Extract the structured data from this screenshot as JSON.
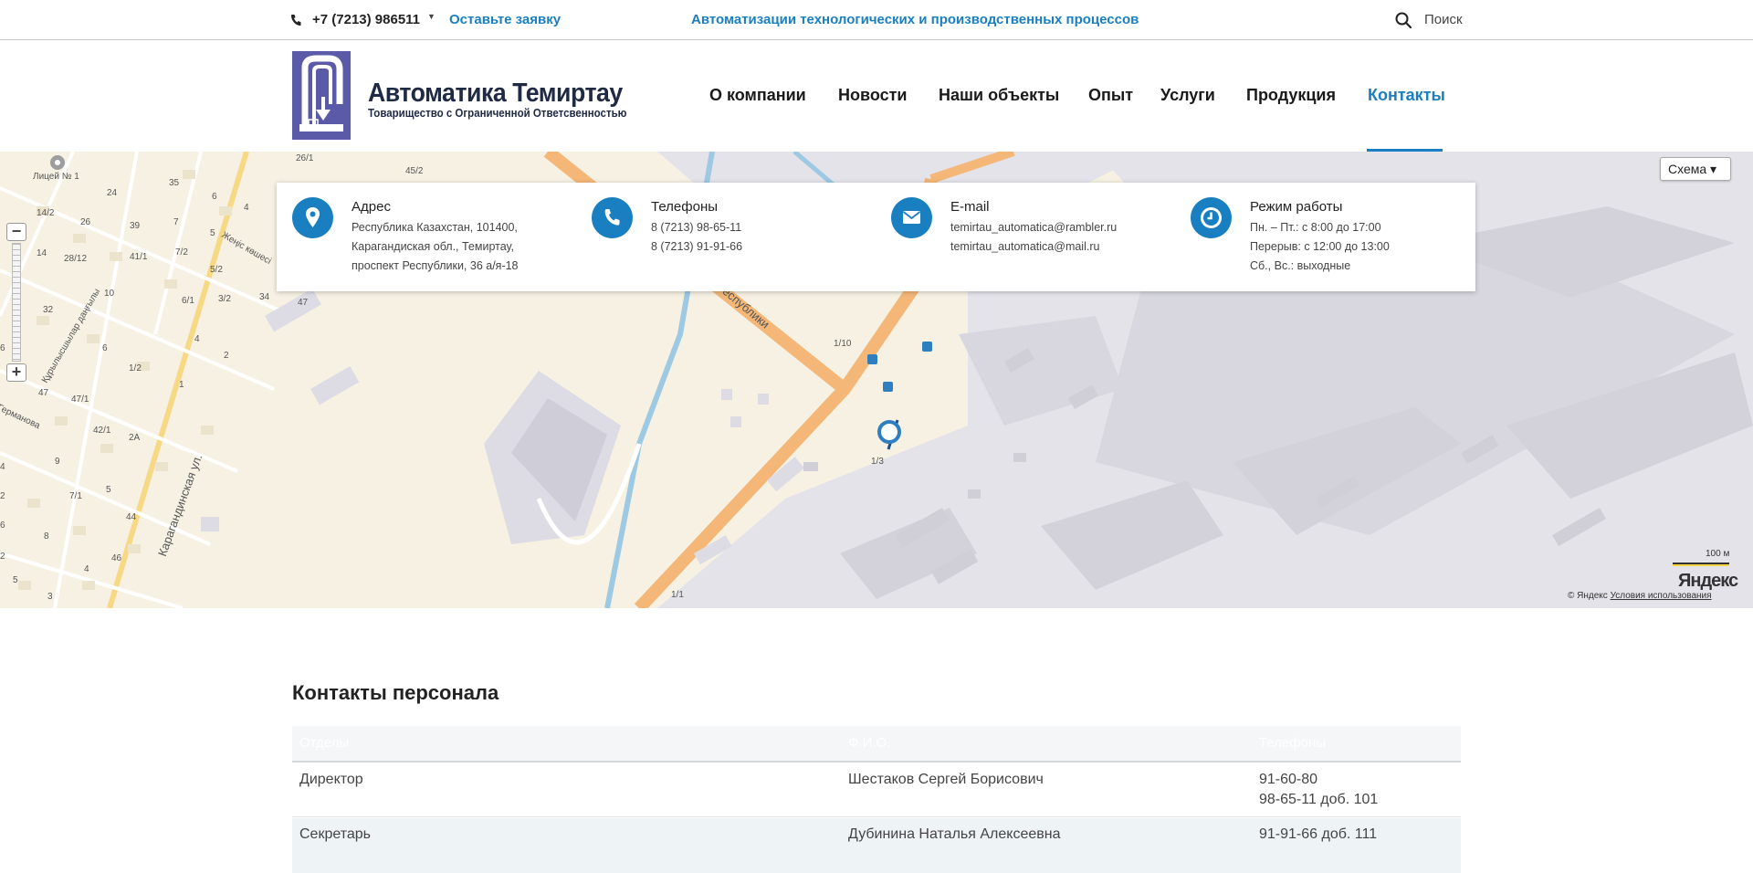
{
  "topbar": {
    "phone": "+7 (7213) 986511",
    "request_link": "Оставьте заявку",
    "slogan": "Автоматизации технологических и производственных процессов",
    "search_label": "Поиск"
  },
  "header": {
    "logo_title": "Автоматика Темиртау",
    "logo_subtitle": "Товарищество с Ограниченной Ответсвенностью",
    "nav": [
      {
        "label": "О компании"
      },
      {
        "label": "Новости"
      },
      {
        "label": "Наши объекты"
      },
      {
        "label": "Опыт"
      },
      {
        "label": "Услуги"
      },
      {
        "label": "Продукция"
      },
      {
        "label": "Контакты",
        "active": true
      }
    ]
  },
  "map": {
    "schema_button": "Схема ▾",
    "scale": "100 м",
    "provider_logo": "Яндекс",
    "copyright": "© Яндекс",
    "terms": "Условия использования",
    "labels": {
      "lyceum": "Лицей № 1",
      "street_karaganda": "Карагандинская ул.",
      "street_republic": "Республики",
      "street_zhenis": "Жеңіс көшесі",
      "street_kurylysshylar": "Құрылысшылар даңғылы",
      "street_germanova": "Германова",
      "h1": "26/1",
      "h2": "45/2",
      "h3": "35",
      "h4": "24",
      "h5": "14/2",
      "h6": "26",
      "h7": "39",
      "h8": "14",
      "h9": "28/12",
      "h10": "41/1",
      "h11": "7/2",
      "h12": "5/2",
      "h13": "10",
      "h14": "6/1",
      "h15": "3/2",
      "h16": "34",
      "h17": "47",
      "h18": "32",
      "h19": "4",
      "h20": "2",
      "h21": "1/2",
      "h22": "1",
      "h23": "47/1",
      "h24": "42/1",
      "h25": "2A",
      "h26": "9",
      "h27": "7/1",
      "h28": "5",
      "h29": "44",
      "h30": "8",
      "h31": "46",
      "h32": "6",
      "h33": "3",
      "h34": "1/10",
      "h35": "1/3",
      "h36": "1/1",
      "h37": "6",
      "h38": "4",
      "h39": "5",
      "h40": "7",
      "h41": "6",
      "h42": "47",
      "h43": "4",
      "h44": "2",
      "h45": "5",
      "h46": "2",
      "h47": "4",
      "h48": "6"
    }
  },
  "contacts": {
    "address": {
      "title": "Адрес",
      "lines": [
        "Республика Казахстан, 101400,",
        "Карагандиская обл., Темиртау,",
        "проспект Республики, 36 а/я-18"
      ]
    },
    "phones": {
      "title": "Телефоны",
      "lines": [
        "8 (7213) 98-65-11",
        "8 (7213) 91-91-66"
      ]
    },
    "email": {
      "title": "E-mail",
      "lines": [
        "temirtau_automatica@rambler.ru",
        "temirtau_automatica@mail.ru"
      ]
    },
    "hours": {
      "title": "Режим работы",
      "lines": [
        "Пн. – Пт.: с 8:00 до 17:00",
        "Перерыв: с 12:00 до 13:00",
        "Сб., Вс.: выходные"
      ]
    }
  },
  "staff": {
    "title": "Контакты персонала",
    "columns": [
      "Отделы",
      "Ф.И.О.",
      "Телефоны"
    ],
    "rows": [
      {
        "dept": "Директор",
        "name": "Шестаков Сергей Борисович",
        "phones": [
          "91-60-80",
          "98-65-11 доб. 101"
        ]
      },
      {
        "dept": "Секретарь",
        "name": "Дубинина Наталья Алексеевна",
        "phones": [
          "91-91-66 доб. 111"
        ]
      }
    ]
  },
  "colors": {
    "accent": "#1a7fc1",
    "logo_blue": "#5a5aa8",
    "map_land": "#f6f1e3",
    "map_industrial": "#e4e3ea",
    "road_orange": "#f4b777"
  }
}
